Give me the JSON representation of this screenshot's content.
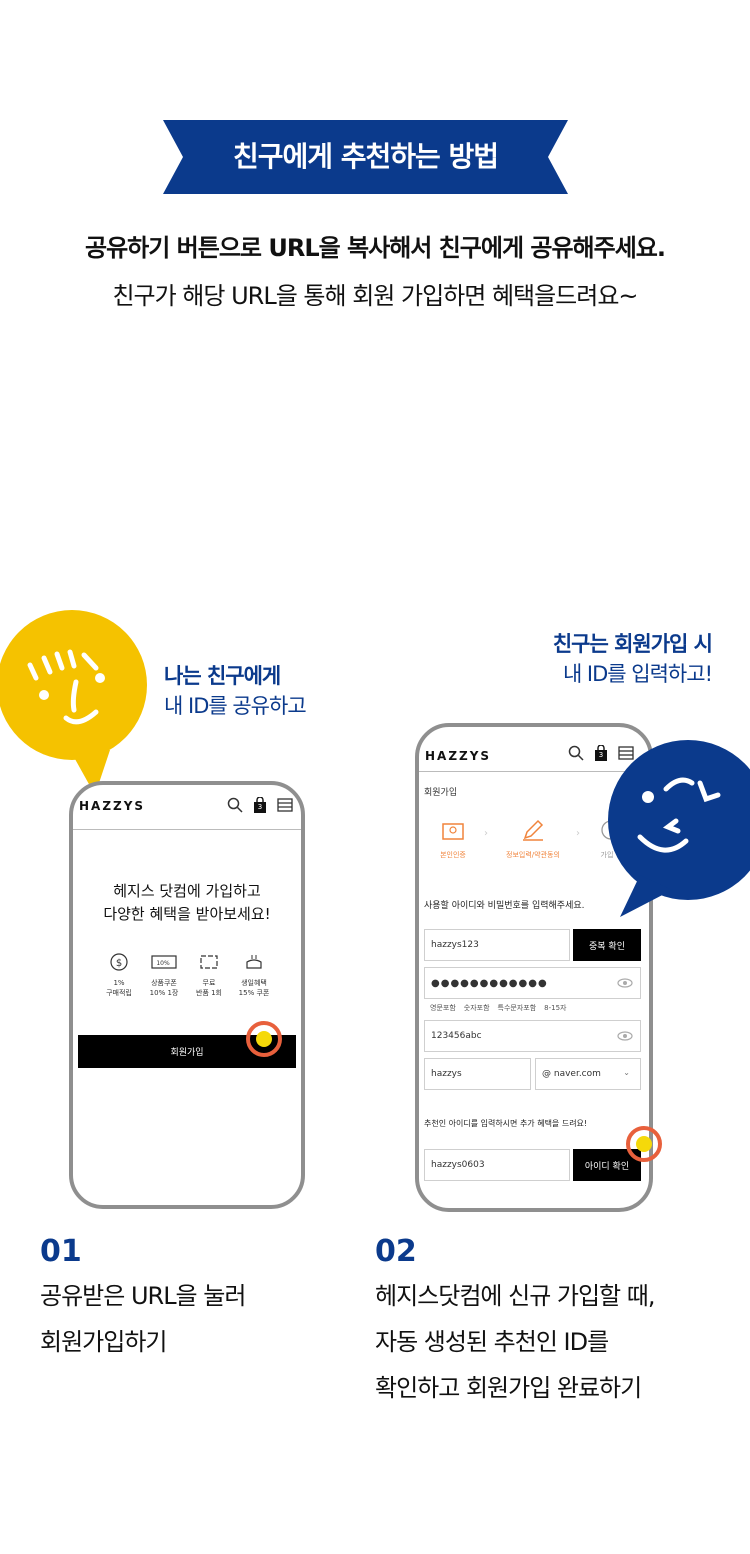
{
  "banner": {
    "title": "친구에게 추천하는 방법"
  },
  "intro": {
    "line1": "공유하기 버튼으로 URL을 복사해서 친구에게 공유해주세요.",
    "line2": "친구가 해당 URL을 통해 회원 가입하면 혜택을드려요~"
  },
  "captions": {
    "left_line1": "나는 친구에게",
    "left_line2": "내 ID를 공유하고",
    "right_line1": "친구는 회원가입 시",
    "right_line2": "내 ID를 입력하고!"
  },
  "phone1": {
    "logo": "HAZZYS",
    "headline1": "헤지스 닷컴에 가입하고",
    "headline2": "다양한 혜택을 받아보세요!",
    "benefits": [
      {
        "icon": "coin-icon",
        "line1": "1%",
        "line2": "구매적립"
      },
      {
        "icon": "coupon-icon",
        "badge": "10%",
        "line1": "상품쿠폰",
        "line2": "10% 1장"
      },
      {
        "icon": "return-icon",
        "line1": "무료",
        "line2": "반품 1회"
      },
      {
        "icon": "cake-icon",
        "line1": "생일혜택",
        "line2": "15% 쿠폰"
      }
    ],
    "join_button": "회원가입",
    "cart_count": "3"
  },
  "phone2": {
    "logo": "HAZZYS",
    "page_title": "회원가입",
    "steps": [
      "본인인증",
      "정보입력/약관동의",
      "가입"
    ],
    "instruction": "사용할 아이디와 비밀번호를 입력해주세요.",
    "id_value": "hazzys123",
    "dup_check": "중복 확인",
    "password_value": "●●●●●●●●●●●●",
    "pw_rules": [
      "영문포함",
      "숫자포함",
      "특수문자포함",
      "8-15자"
    ],
    "password_confirm_value": "123456abc",
    "email_local": "hazzys",
    "email_domain": "@ naver.com",
    "recommend_text": "추천인 아이디를 입력하시면 추가 혜택을 드려요!",
    "recommend_value": "hazzys0603",
    "id_check": "아이디 확인",
    "cart_count": "3"
  },
  "steps": [
    {
      "num": "01",
      "line1": "공유받은 URL을 눌러",
      "line2": "회원가입하기"
    },
    {
      "num": "02",
      "line1": "헤지스닷컴에 신규 가입할 때,",
      "line2": "자동 생성된 추천인 ID를",
      "line3": "확인하고 회원가입 완료하기"
    }
  ],
  "colors": {
    "navy": "#0b3a8c",
    "yellow": "#f5c200",
    "orange": "#f0843c"
  }
}
